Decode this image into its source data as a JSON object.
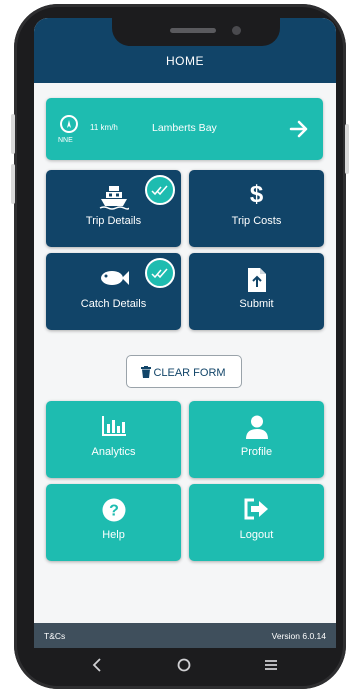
{
  "header": {
    "title": "HOME"
  },
  "weather": {
    "wind_direction": "NNE",
    "wind_speed": "11 km/h",
    "location": "Lamberts Bay",
    "compass_icon": "compass-icon",
    "arrow_icon": "arrow-right-icon"
  },
  "tiles": [
    {
      "label": "Trip Details",
      "icon": "ship-icon",
      "completed": true
    },
    {
      "label": "Trip Costs",
      "icon": "dollar-icon",
      "completed": false
    },
    {
      "label": "Catch Details",
      "icon": "fish-icon",
      "completed": true
    },
    {
      "label": "Submit",
      "icon": "upload-file-icon",
      "completed": false
    }
  ],
  "clear_form": {
    "label": "CLEAR FORM",
    "icon": "trash-icon"
  },
  "menu": [
    {
      "label": "Analytics",
      "icon": "bar-chart-icon"
    },
    {
      "label": "Profile",
      "icon": "person-icon"
    },
    {
      "label": "Help",
      "icon": "help-icon"
    },
    {
      "label": "Logout",
      "icon": "logout-icon"
    }
  ],
  "footer": {
    "tcs": "T&Cs",
    "version": "Version 6.0.14"
  },
  "navigation": {
    "back": "back-icon",
    "home": "home-icon",
    "menu": "menu-icon"
  },
  "colors": {
    "navy": "#114468",
    "teal": "#1ebcb0",
    "footer": "#3f4f5c",
    "background": "#f5f6f7"
  }
}
